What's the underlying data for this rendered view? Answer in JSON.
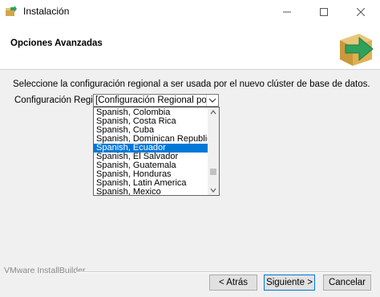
{
  "window": {
    "title": "Instalación"
  },
  "header": {
    "title": "Opciones Avanzadas",
    "icon": "installer-arrow-box-icon"
  },
  "main": {
    "instruction": "Seleccione la configuración regional a ser usada por el nuevo clúster de base de datos.",
    "field_label": "Configuración Regional",
    "select_value": "[Configuración Regional por defecto]",
    "options": [
      "Spanish, Colombia",
      "Spanish, Costa Rica",
      "Spanish, Cuba",
      "Spanish, Dominican Republic",
      "Spanish, Ecuador",
      "Spanish, El Salvador",
      "Spanish, Guatemala",
      "Spanish, Honduras",
      "Spanish, Latin America",
      "Spanish, Mexico"
    ],
    "selected_option": "Spanish, Ecuador"
  },
  "footer": {
    "brand": "VMware InstallBuilder",
    "back_label": "< Atrás",
    "next_label": "Siguiente >",
    "cancel_label": "Cancelar"
  },
  "colors": {
    "selection": "#0078d7",
    "header_bg": "#ffffff",
    "body_bg": "#f0f0f0"
  }
}
